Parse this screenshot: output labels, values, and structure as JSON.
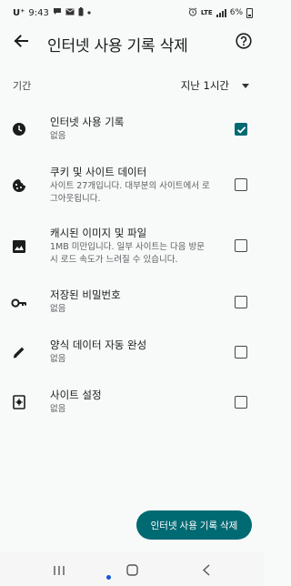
{
  "status_bar": {
    "carrier": "U⁺",
    "time": "9:43",
    "network": "LTE",
    "battery": "6%",
    "notification_icons": [
      "chat-icon",
      "mail-icon",
      "battery-saver-icon",
      "dot-icon"
    ],
    "right_icons": [
      "alarm-icon",
      "lte-icon",
      "signal-icon",
      "battery-icon"
    ]
  },
  "app_bar": {
    "title": "인터넷 사용 기록 삭제",
    "back_icon": "arrow-back-icon",
    "help_icon": "help-circle-icon"
  },
  "time_range": {
    "label": "기간",
    "value": "지난 1시간"
  },
  "items": [
    {
      "title": "인터넷 사용 기록",
      "subtitle": "없음",
      "icon": "clock-icon",
      "checked": true
    },
    {
      "title": "쿠키 및 사이트 데이터",
      "subtitle": "사이트 27개입니다. 대부분의 사이트에서 로그아웃됩니다.",
      "icon": "cookie-icon",
      "checked": false
    },
    {
      "title": "캐시된 이미지 및 파일",
      "subtitle": "1MB 미만입니다. 일부 사이트는 다음 방문 시 로드 속도가 느려질 수 있습니다.",
      "icon": "image-icon",
      "checked": false
    },
    {
      "title": "저장된 비밀번호",
      "subtitle": "없음",
      "icon": "key-icon",
      "checked": false
    },
    {
      "title": "양식 데이터 자동 완성",
      "subtitle": "없음",
      "icon": "pencil-icon",
      "checked": false
    },
    {
      "title": "사이트 설정",
      "subtitle": "없음",
      "icon": "site-settings-icon",
      "checked": false
    }
  ],
  "primary_button": {
    "label": "인터넷 사용 기록 삭제"
  },
  "colors": {
    "accent": "#006a73",
    "background": "#f8fafa",
    "text": "#1b1c1c"
  }
}
